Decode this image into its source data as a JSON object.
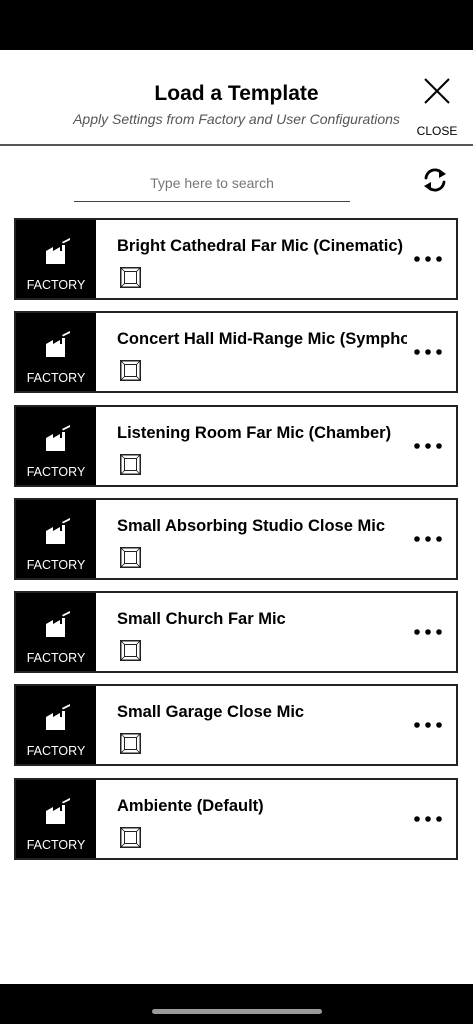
{
  "header": {
    "title": "Load a Template",
    "subtitle": "Apply Settings from Factory and User Configurations",
    "close_label": "CLOSE"
  },
  "search": {
    "placeholder": "Type here to search",
    "value": ""
  },
  "icons": {
    "close": "close-icon",
    "refresh": "refresh-icon",
    "factory": "factory-icon",
    "checkbox": "checkbox-icon",
    "more": "more-horizontal-icon"
  },
  "templates": [
    {
      "source": "FACTORY",
      "name": "Bright Cathedral Far Mic (Cinematic)",
      "checked": false
    },
    {
      "source": "FACTORY",
      "name": "Concert Hall Mid-Range Mic (Symphonic)",
      "checked": false
    },
    {
      "source": "FACTORY",
      "name": "Listening Room Far Mic (Chamber)",
      "checked": false
    },
    {
      "source": "FACTORY",
      "name": "Small Absorbing Studio Close Mic",
      "checked": false
    },
    {
      "source": "FACTORY",
      "name": "Small Church Far Mic",
      "checked": false
    },
    {
      "source": "FACTORY",
      "name": "Small Garage Close Mic",
      "checked": false
    },
    {
      "source": "FACTORY",
      "name": "Ambiente (Default)",
      "checked": false
    }
  ]
}
